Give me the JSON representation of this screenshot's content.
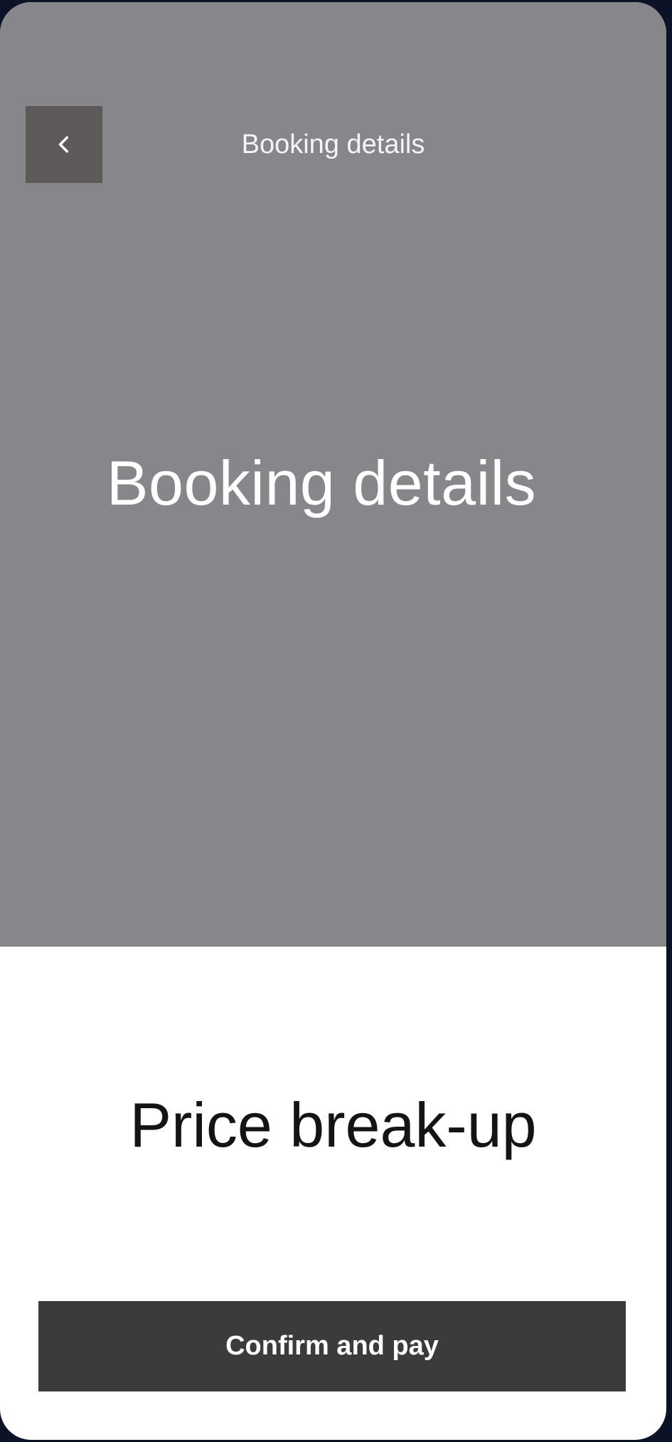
{
  "header": {
    "back_icon": "chevron-left-icon",
    "title": "Booking details"
  },
  "hero": {
    "title": "Booking details"
  },
  "price_section": {
    "title": "Price break-up"
  },
  "footer": {
    "confirm_label": "Confirm and pay"
  },
  "colors": {
    "hero_background": "#87878b",
    "back_button_background": "#5e5a59",
    "cta_background": "#3b3b3c",
    "page_background": "#ffffff"
  }
}
